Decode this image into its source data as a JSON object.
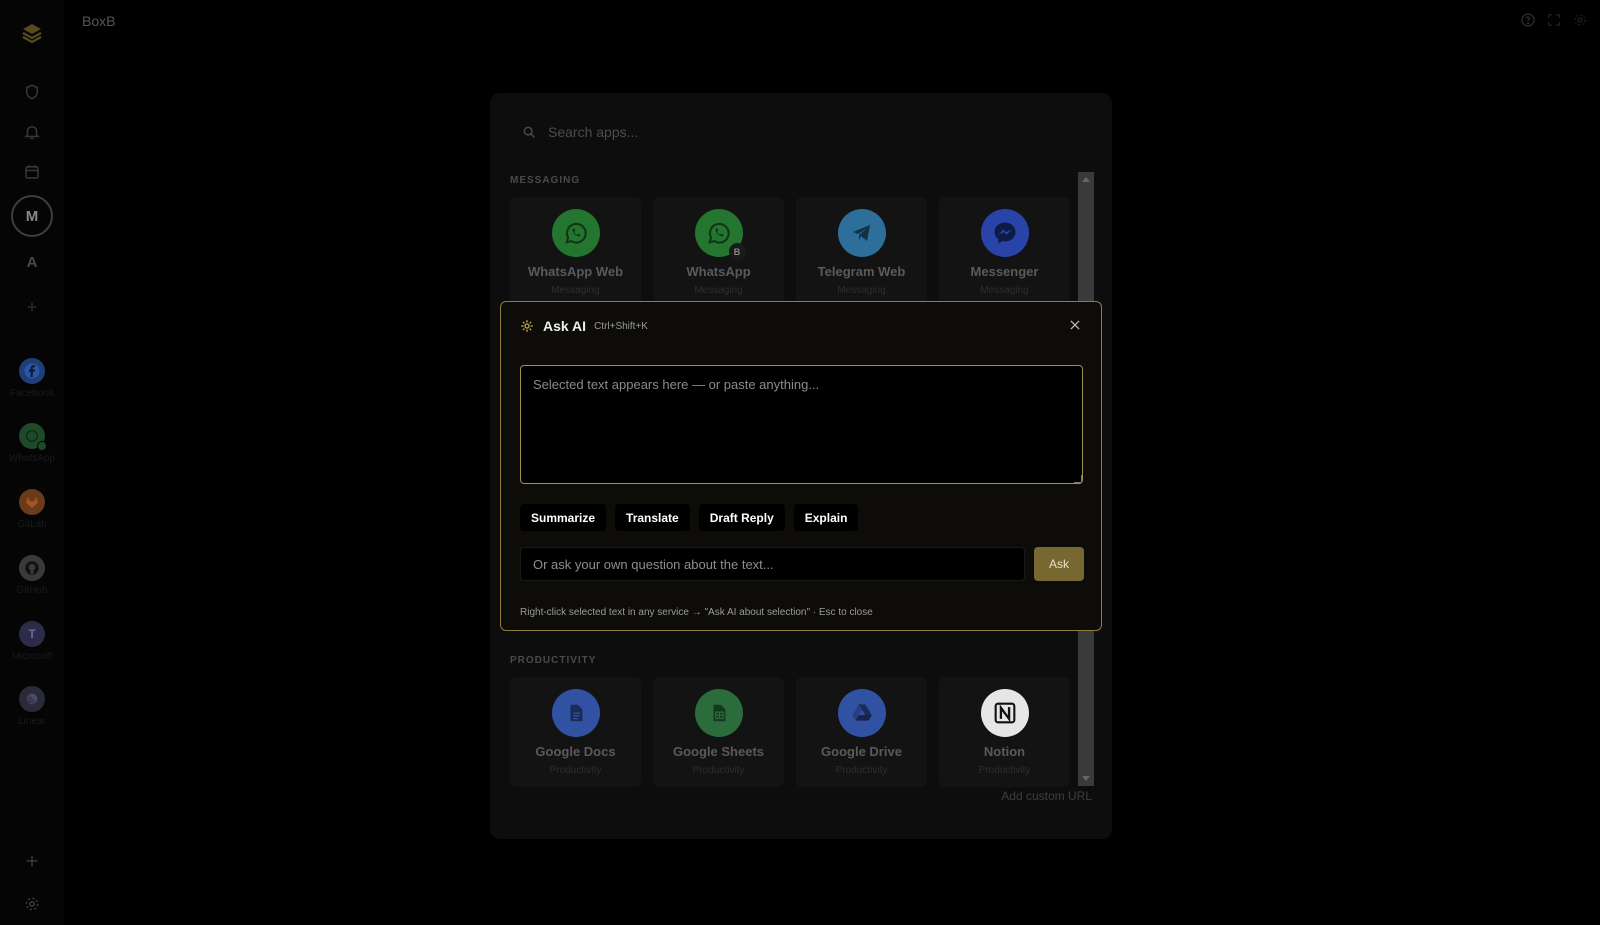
{
  "app": {
    "title": "BoxB"
  },
  "sidebar": {
    "avatar_letter": "M",
    "letter_item": "A",
    "services": [
      {
        "label": "Facebook",
        "icon": "facebook-icon",
        "color": "#1f3f7a"
      },
      {
        "label": "WhatsApp",
        "icon": "whatsapp-icon",
        "color": "#1e4a2a"
      },
      {
        "label": "GitLab",
        "icon": "gitlab-icon",
        "color": "#6b3a1a"
      },
      {
        "label": "GitHub",
        "icon": "github-icon",
        "color": "#3a3a3a"
      },
      {
        "label": "Microsoft",
        "icon": "teams-icon",
        "color": "#2c2c4a"
      },
      {
        "label": "Linear",
        "icon": "linear-icon",
        "color": "#2a2a3a"
      }
    ]
  },
  "picker": {
    "search_placeholder": "Search apps...",
    "sections": {
      "messaging": {
        "label": "MESSAGING",
        "apps": [
          {
            "name": "WhatsApp Web",
            "category": "Messaging",
            "icon": "whatsapp-icon",
            "color": "#23752f"
          },
          {
            "name": "WhatsApp",
            "category": "Messaging",
            "icon": "whatsapp-business-icon",
            "color": "#23752f",
            "badge": "B"
          },
          {
            "name": "Telegram Web",
            "category": "Messaging",
            "icon": "telegram-icon",
            "color": "#2e6e9b"
          },
          {
            "name": "Messenger",
            "category": "Messaging",
            "icon": "messenger-icon",
            "color": "#2943a8"
          }
        ]
      },
      "productivity": {
        "label": "PRODUCTIVITY",
        "apps": [
          {
            "name": "Google Docs",
            "category": "Productivity",
            "icon": "google-docs-icon",
            "color": "#3152a3"
          },
          {
            "name": "Google Sheets",
            "category": "Productivity",
            "icon": "google-sheets-icon",
            "color": "#2a6c3b"
          },
          {
            "name": "Google Drive",
            "category": "Productivity",
            "icon": "google-drive-icon",
            "color": "#3152a3"
          },
          {
            "name": "Notion",
            "category": "Productivity",
            "icon": "notion-icon",
            "color": "#e6e6e6"
          }
        ]
      }
    },
    "add_custom_url": "Add custom URL"
  },
  "ask_ai": {
    "title": "Ask AI",
    "shortcut": "Ctrl+Shift+K",
    "textarea_placeholder": "Selected text appears here — or paste anything...",
    "actions": [
      "Summarize",
      "Translate",
      "Draft Reply",
      "Explain"
    ],
    "question_placeholder": "Or ask your own question about the text...",
    "ask_label": "Ask",
    "footer": "Right-click selected text in any service → \"Ask AI about selection\" · Esc to close",
    "accent_color": "#8f7d3c"
  }
}
